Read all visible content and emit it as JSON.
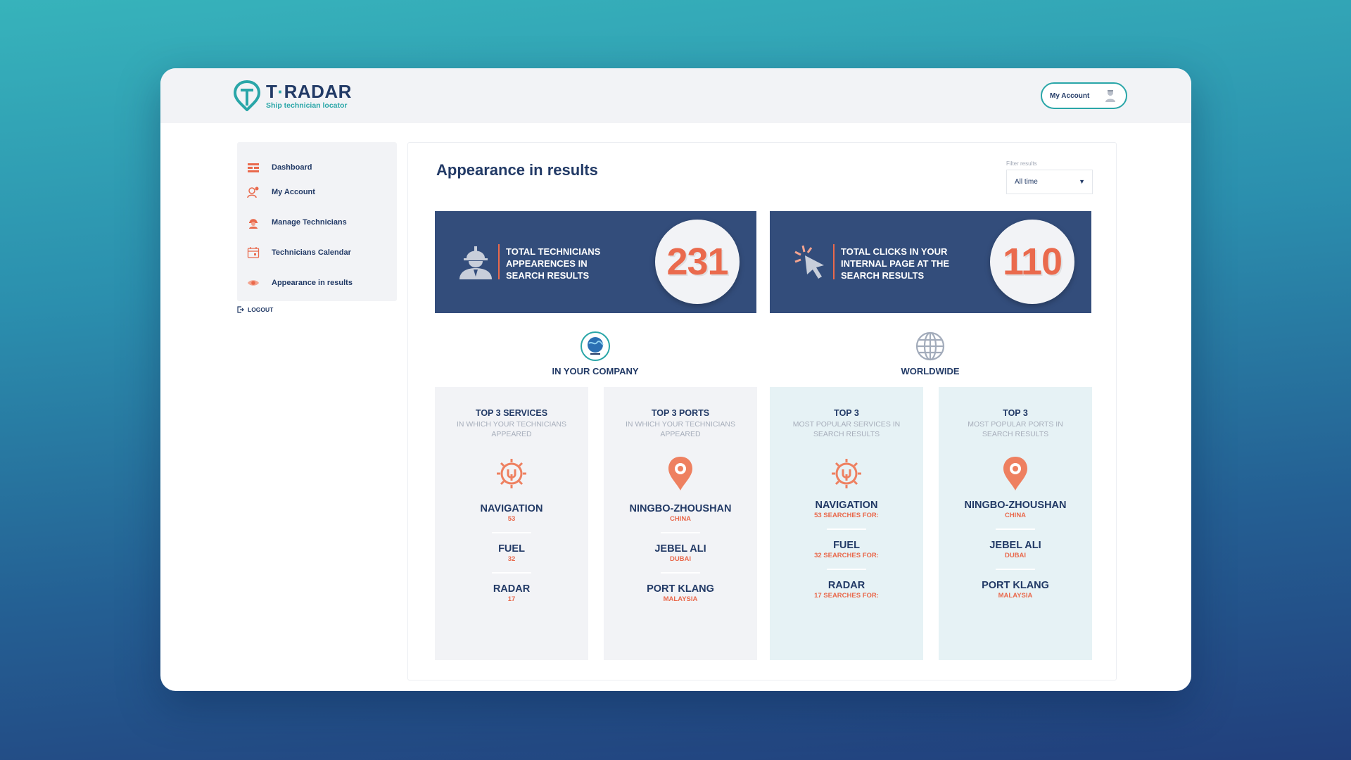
{
  "app": {
    "title": "T·RADAR",
    "title_prefix": "T",
    "title_dot": "·",
    "title_suffix": "RADAR",
    "subtitle": "Ship technician locator"
  },
  "header": {
    "account_label": "My Account"
  },
  "sidebar": {
    "items": [
      {
        "label": "Dashboard",
        "icon": "dashboard-icon"
      },
      {
        "label": "My Account",
        "icon": "user-icon"
      },
      {
        "label": "Manage Technicians",
        "icon": "technician-icon"
      },
      {
        "label": "Technicians Calendar",
        "icon": "calendar-icon"
      },
      {
        "label": "Appearance in results",
        "icon": "eye-icon"
      }
    ],
    "logout": "LOGOUT"
  },
  "main": {
    "title": "Appearance in results",
    "filter": {
      "label": "Filter results",
      "value": "All time"
    },
    "stats": [
      {
        "text": "Total technicians appearences in search results",
        "value": "231",
        "icon": "worker-icon"
      },
      {
        "text": "Total clicks in your internal page at the search results",
        "value": "110",
        "icon": "cursor-click-icon"
      }
    ],
    "groups": [
      {
        "label": "IN YOUR COMPANY",
        "icon": "company-logo-icon"
      },
      {
        "label": "WORLDWIDE",
        "icon": "globe-icon"
      }
    ],
    "cards": [
      {
        "title": "TOP 3 SERVICES",
        "subtitle": "IN WHICH YOUR TECHNICIANS APPEARED",
        "icon": "gear-icon",
        "items": [
          {
            "name": "NAVIGATION",
            "value": "53"
          },
          {
            "name": "FUEL",
            "value": "32"
          },
          {
            "name": "RADAR",
            "value": "17"
          }
        ]
      },
      {
        "title": "TOP 3 PORTS",
        "subtitle": "IN WHICH YOUR TECHNICIANS APPEARED",
        "icon": "location-pin-icon",
        "items": [
          {
            "name": "NINGBO-ZHOUSHAN",
            "value": "CHINA"
          },
          {
            "name": "JEBEL ALI",
            "value": "DUBAI"
          },
          {
            "name": "PORT KLANG",
            "value": "MALAYSIA"
          }
        ]
      },
      {
        "title": "TOP 3",
        "subtitle": "MOST POPULAR SERVICES IN SEARCH RESULTS",
        "icon": "gear-icon",
        "items": [
          {
            "name": "NAVIGATION",
            "value": "53 SEARCHES FOR:"
          },
          {
            "name": "FUEL",
            "value": "32 SEARCHES FOR:"
          },
          {
            "name": "RADAR",
            "value": "17 SEARCHES FOR:"
          }
        ]
      },
      {
        "title": "TOP 3",
        "subtitle": "MOST POPULAR PORTS IN SEARCH RESULTS",
        "icon": "location-pin-icon",
        "items": [
          {
            "name": "NINGBO-ZHOUSHAN",
            "value": "CHINA"
          },
          {
            "name": "JEBEL ALI",
            "value": "DUBAI"
          },
          {
            "name": "PORT KLANG",
            "value": "MALAYSIA"
          }
        ]
      }
    ]
  },
  "colors": {
    "navy": "#223a66",
    "stat_bg": "#334d7b",
    "accent": "#e9694c",
    "teal": "#2aa6a8",
    "card_grey": "#f2f3f6",
    "card_teal": "#e6f2f5"
  }
}
